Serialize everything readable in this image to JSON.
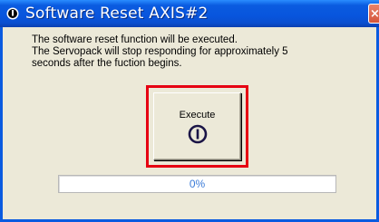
{
  "window": {
    "title": "Software Reset AXIS#2",
    "title_icon": "info-icon",
    "close_icon": "close-icon",
    "close_glyph": "×"
  },
  "message": {
    "lines": [
      "The software reset function will be executed.",
      "The Servopack will stop responding for approximately 5",
      "seconds after the fuction begins."
    ]
  },
  "execute_button": {
    "label": "Execute",
    "icon": "power-icon",
    "highlighted": true,
    "highlight_color": "#e60012"
  },
  "progress": {
    "value": 0,
    "label": "0%"
  },
  "colors": {
    "titlebar": "#0a5be0",
    "progress_text": "#3b7bd8",
    "window_bg": "#ece9d8"
  }
}
